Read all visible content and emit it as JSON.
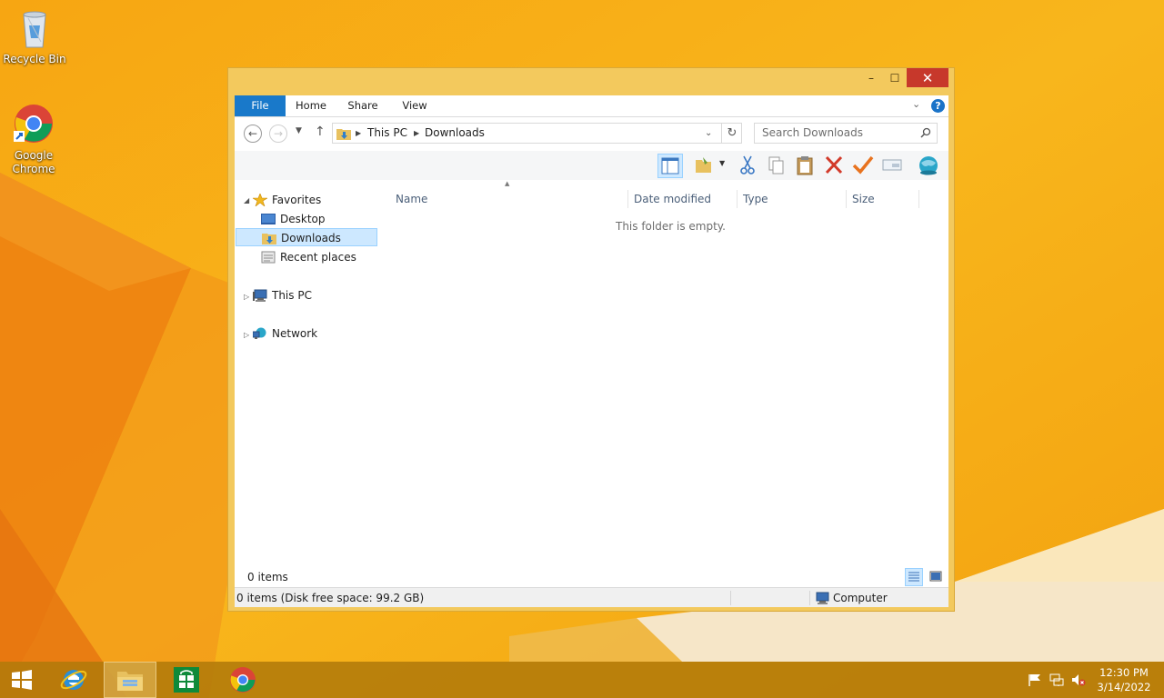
{
  "desktop": {
    "icons": [
      {
        "label": "Recycle Bin",
        "icon": "recycle-bin-icon"
      },
      {
        "label": "Google Chrome",
        "icon": "chrome-icon"
      }
    ]
  },
  "window": {
    "controls": {
      "minimize": "–",
      "maximize": "☐",
      "close": "✕"
    },
    "ribbon": {
      "tabs": [
        "File",
        "Home",
        "Share",
        "View"
      ],
      "expand_glyph": "⌄",
      "help_glyph": "?"
    },
    "address": {
      "breadcrumb": [
        "This PC",
        "Downloads"
      ],
      "search_placeholder": "Search Downloads"
    },
    "nav_pane": {
      "favorites": "Favorites",
      "favorites_items": [
        "Desktop",
        "Downloads",
        "Recent places"
      ],
      "selected": "Downloads",
      "this_pc": "This PC",
      "network": "Network"
    },
    "columns": [
      "Name",
      "Date modified",
      "Type",
      "Size"
    ],
    "empty_message": "This folder is empty.",
    "item_count": "0 items",
    "status": {
      "text": "0 items (Disk free space: 99.2 GB)",
      "zone": "Computer"
    }
  },
  "taskbar": {
    "apps": [
      "start-icon",
      "internet-explorer-icon",
      "file-explorer-icon",
      "store-icon",
      "chrome-icon"
    ],
    "active_app": "file-explorer-icon",
    "tray": [
      "flag-icon",
      "network-icon",
      "volume-muted-icon"
    ],
    "time": "12:30 PM",
    "date": "3/14/2022"
  },
  "colors": {
    "accent": "#1979ca",
    "wallpaper": "#f6ac16",
    "window_frame": "#f3c95d",
    "close_button": "#c7382b",
    "selection": "#cde8ff"
  }
}
